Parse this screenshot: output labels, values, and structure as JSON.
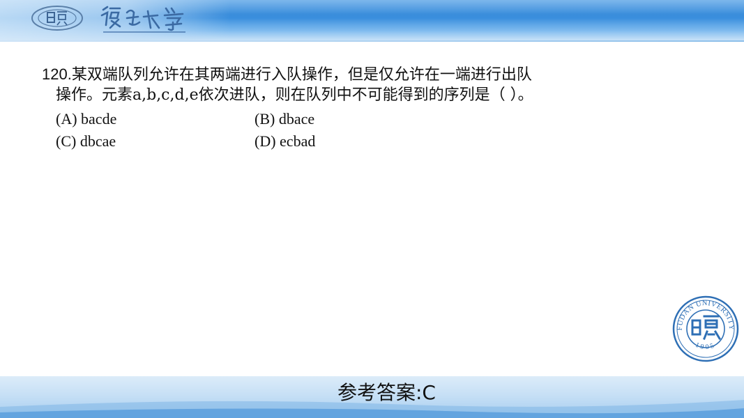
{
  "header": {
    "logo_seal_name": "fudan-seal-small",
    "logo_script_name": "fudan-calligraphy-logo"
  },
  "question": {
    "number": "120.",
    "stem_line1": "某双端队列允许在其两端进行入队操作，但是仅允许在一端进行出队",
    "stem_line2": "操作。元素a,b,c,d,e依次进队，则在队列中不可能得到的序列是（  ）。"
  },
  "options": [
    {
      "label": "(A) bacde"
    },
    {
      "label": "(B) dbace"
    },
    {
      "label": "(C) dbcae"
    },
    {
      "label": "(D) ecbad"
    }
  ],
  "footer": {
    "answer_text": "参考答案:C"
  },
  "seal": {
    "text_top": "FUDAN UNIVERSITY",
    "year": "1905"
  },
  "colors": {
    "header_blue": "#2e86d9",
    "footer_blue": "#a6cdef",
    "seal_blue": "#2e6fb5"
  }
}
